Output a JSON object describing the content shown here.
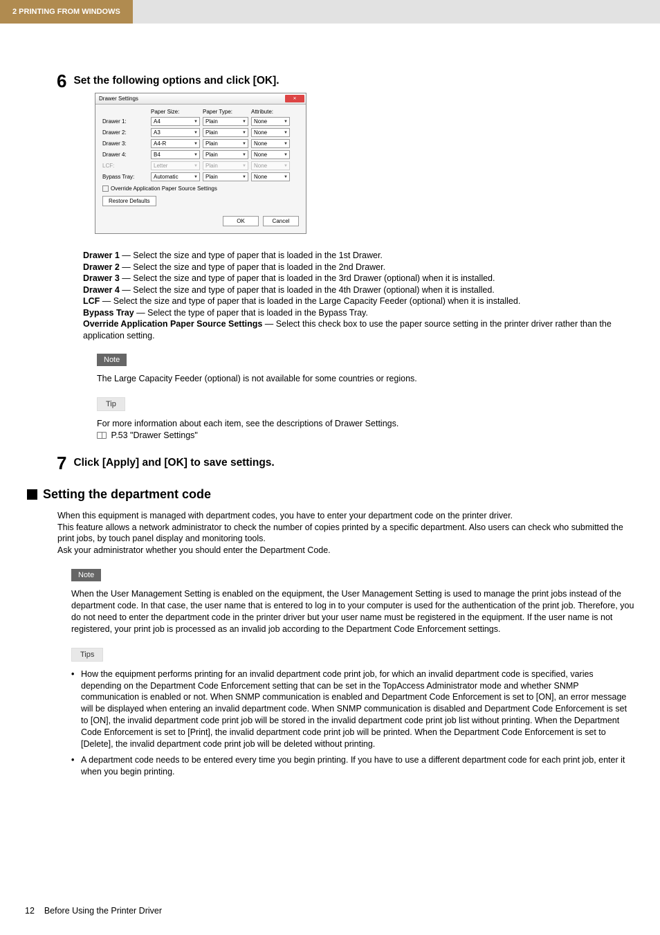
{
  "header": {
    "section": "2 PRINTING FROM WINDOWS"
  },
  "step6": {
    "num": "6",
    "text": "Set the following options and click [OK]."
  },
  "dialog": {
    "title": "Drawer Settings",
    "close": "✕",
    "columns": {
      "c1": "Paper Size:",
      "c2": "Paper Type:",
      "c3": "Attribute:"
    },
    "rows": [
      {
        "label": "Drawer 1:",
        "size": "A4",
        "type": "Plain",
        "attr": "None",
        "disabled": false
      },
      {
        "label": "Drawer 2:",
        "size": "A3",
        "type": "Plain",
        "attr": "None",
        "disabled": false
      },
      {
        "label": "Drawer 3:",
        "size": "A4-R",
        "type": "Plain",
        "attr": "None",
        "disabled": false
      },
      {
        "label": "Drawer 4:",
        "size": "B4",
        "type": "Plain",
        "attr": "None",
        "disabled": false
      },
      {
        "label": "LCF:",
        "size": "Letter",
        "type": "Plain",
        "attr": "None",
        "disabled": true
      },
      {
        "label": "Bypass Tray:",
        "size": "Automatic",
        "type": "Plain",
        "attr": "None",
        "disabled": false
      }
    ],
    "override": "Override Application Paper Source Settings",
    "restore": "Restore Defaults",
    "ok": "OK",
    "cancel": "Cancel"
  },
  "desc": {
    "d1a": "Drawer 1",
    "d1b": " — Select the size and type of paper that is loaded in the 1st Drawer.",
    "d2a": "Drawer 2",
    "d2b": " — Select the size and type of paper that is loaded in the 2nd Drawer.",
    "d3a": "Drawer 3",
    "d3b": " — Select the size and type of paper that is loaded in the 3rd Drawer (optional) when it is installed.",
    "d4a": "Drawer 4",
    "d4b": " — Select the size and type of paper that is loaded in the 4th Drawer (optional) when it is installed.",
    "d5a": "LCF",
    "d5b": " — Select the size and type of paper that is loaded in the Large Capacity Feeder (optional) when it is installed.",
    "d6a": "Bypass Tray",
    "d6b": " — Select the type of paper that is loaded in the Bypass Tray.",
    "d7a": "Override Application Paper Source Settings",
    "d7b": " — Select this check box to use the paper source setting in the printer driver rather than the application setting."
  },
  "note1": {
    "label": "Note",
    "text": "The Large Capacity Feeder (optional) is not available for some countries or regions."
  },
  "tip1": {
    "label": "Tip",
    "line1": "For more information about each item, see the descriptions of Drawer Settings.",
    "line2": " P.53 \"Drawer Settings\""
  },
  "step7": {
    "num": "7",
    "text": "Click [Apply] and [OK] to save settings."
  },
  "section2": {
    "title": "Setting the department code",
    "body": "When this equipment is managed with department codes, you have to enter your department code on the printer driver.\nThis feature allows a network administrator to check the number of copies printed by a specific department. Also users can check who submitted the print jobs, by touch panel display and monitoring tools.\nAsk your administrator whether you should enter the Department Code."
  },
  "note2": {
    "label": "Note",
    "text": "When the User Management Setting is enabled on the equipment, the User Management Setting is used to manage the print jobs instead of the department code. In that case, the user name that is entered to log in to your computer is used for the authentication of the print job. Therefore, you do not need to enter the department code in the printer driver but your user name must be registered in the equipment. If the user name is not registered, your print job is processed as an invalid job according to the Department Code Enforcement settings."
  },
  "tips2": {
    "label": "Tips",
    "items": [
      "How the equipment performs printing for an invalid department code print job, for which an invalid department code is specified, varies depending on the Department Code Enforcement setting that can be set in the TopAccess Administrator mode and whether SNMP communication is enabled or not. When SNMP communication is enabled and Department Code Enforcement is set to [ON], an error message will be displayed when entering an invalid department code. When SNMP communication is disabled and Department Code Enforcement is set to [ON], the invalid department code print job will be stored in the invalid department code print job list without printing. When the Department Code Enforcement is set to [Print], the invalid department code print job will be printed. When the Department Code Enforcement is set to [Delete], the invalid department code print job will be deleted without printing.",
      "A department code needs to be entered every time you begin printing. If you have to use a different department code for each print job, enter it when you begin printing."
    ]
  },
  "footer": {
    "page": "12",
    "title": "Before Using the Printer Driver"
  },
  "chart_data": {
    "type": "table",
    "title": "Drawer Settings",
    "columns": [
      "Drawer",
      "Paper Size",
      "Paper Type",
      "Attribute"
    ],
    "rows": [
      [
        "Drawer 1",
        "A4",
        "Plain",
        "None"
      ],
      [
        "Drawer 2",
        "A3",
        "Plain",
        "None"
      ],
      [
        "Drawer 3",
        "A4-R",
        "Plain",
        "None"
      ],
      [
        "Drawer 4",
        "B4",
        "Plain",
        "None"
      ],
      [
        "LCF",
        "Letter",
        "Plain",
        "None"
      ],
      [
        "Bypass Tray",
        "Automatic",
        "Plain",
        "None"
      ]
    ]
  }
}
